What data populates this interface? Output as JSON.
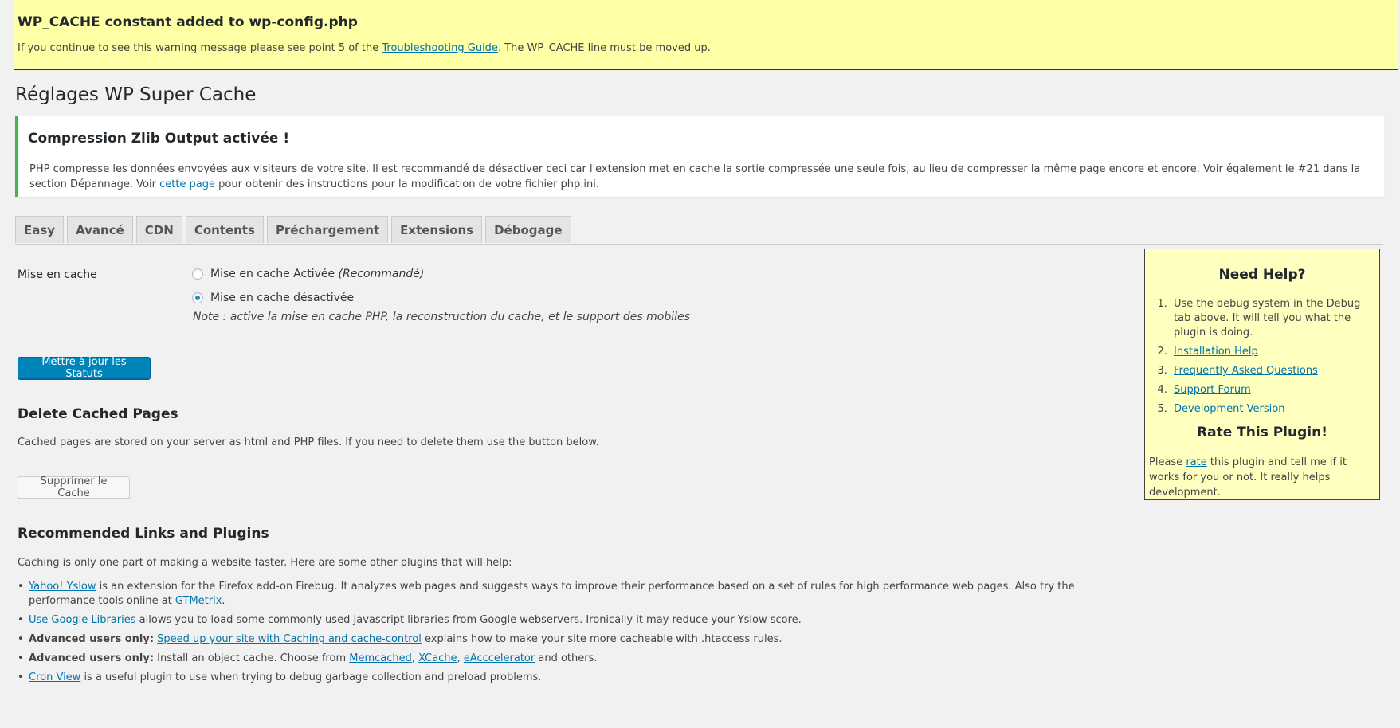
{
  "warning": {
    "title": "WP_CACHE constant added to wp-config.php",
    "text_before": "If you continue to see this warning message please see point 5 of the ",
    "link": "Troubleshooting Guide",
    "text_after": ". The WP_CACHE line must be moved up."
  },
  "page_title": "Réglages WP Super Cache",
  "notice": {
    "title": "Compression Zlib Output activée !",
    "text_before": "PHP compresse les données envoyées aux visiteurs de votre site. Il est recommandé de désactiver ceci car l'extension met en cache la sortie compressée une seule fois, au lieu de compresser la même page encore et encore. Voir également le #21 dans la section Dépannage. Voir ",
    "link": "cette page",
    "text_after": " pour obtenir des instructions pour la modification de votre fichier php.ini."
  },
  "tabs": [
    "Easy",
    "Avancé",
    "CDN",
    "Contents",
    "Préchargement",
    "Extensions",
    "Débogage"
  ],
  "caching": {
    "label": "Mise en cache",
    "option_on": "Mise en cache Activée",
    "option_on_hint": "(Recommandé)",
    "option_off": "Mise en cache désactivée",
    "selected": "off",
    "note": "Note : active la mise en cache PHP, la reconstruction du cache, et le support des mobiles"
  },
  "update_button": "Mettre à jour les Statuts",
  "delete": {
    "heading": "Delete Cached Pages",
    "text": "Cached pages are stored on your server as html and PHP files. If you need to delete them use the button below.",
    "button": "Supprimer le Cache"
  },
  "recommended": {
    "heading": "Recommended Links and Plugins",
    "intro": "Caching is only one part of making a website faster. Here are some other plugins that will help:",
    "items": [
      {
        "link": "Yahoo! Yslow",
        "text": " is an extension for the Firefox add-on Firebug. It analyzes web pages and suggests ways to improve their performance based on a set of rules for high performance web pages. Also try the performance tools online at ",
        "link2": "GTMetrix",
        "text2": "."
      },
      {
        "link": "Use Google Libraries",
        "text": " allows you to load some commonly used Javascript libraries from Google webservers. Ironically it may reduce your Yslow score."
      },
      {
        "bold": "Advanced users only:",
        "link": "Speed up your site with Caching and cache-control",
        "text": " explains how to make your site more cacheable with .htaccess rules."
      },
      {
        "bold": "Advanced users only:",
        "text": " Install an object cache. Choose from ",
        "links": [
          "Memcached",
          "XCache",
          "eAcccelerator"
        ],
        "sep": ", ",
        "text2": " and others."
      },
      {
        "link": "Cron View",
        "text": " is a useful plugin to use when trying to debug garbage collection and preload problems."
      }
    ]
  },
  "help": {
    "title": "Need Help?",
    "item1": "Use the debug system in the Debug tab above. It will tell you what the plugin is doing.",
    "links": [
      "Installation Help",
      "Frequently Asked Questions",
      "Support Forum",
      "Development Version"
    ],
    "rate_title": "Rate This Plugin!",
    "rate_before": "Please ",
    "rate_link": "rate",
    "rate_after": " this plugin and tell me if it works for you or not. It really helps development."
  },
  "colors": {
    "warning_bg": "#ffffa6",
    "notice_border": "#46b450",
    "primary_button": "#0085ba",
    "help_bg": "#ffffc0",
    "link": "#0073aa"
  }
}
